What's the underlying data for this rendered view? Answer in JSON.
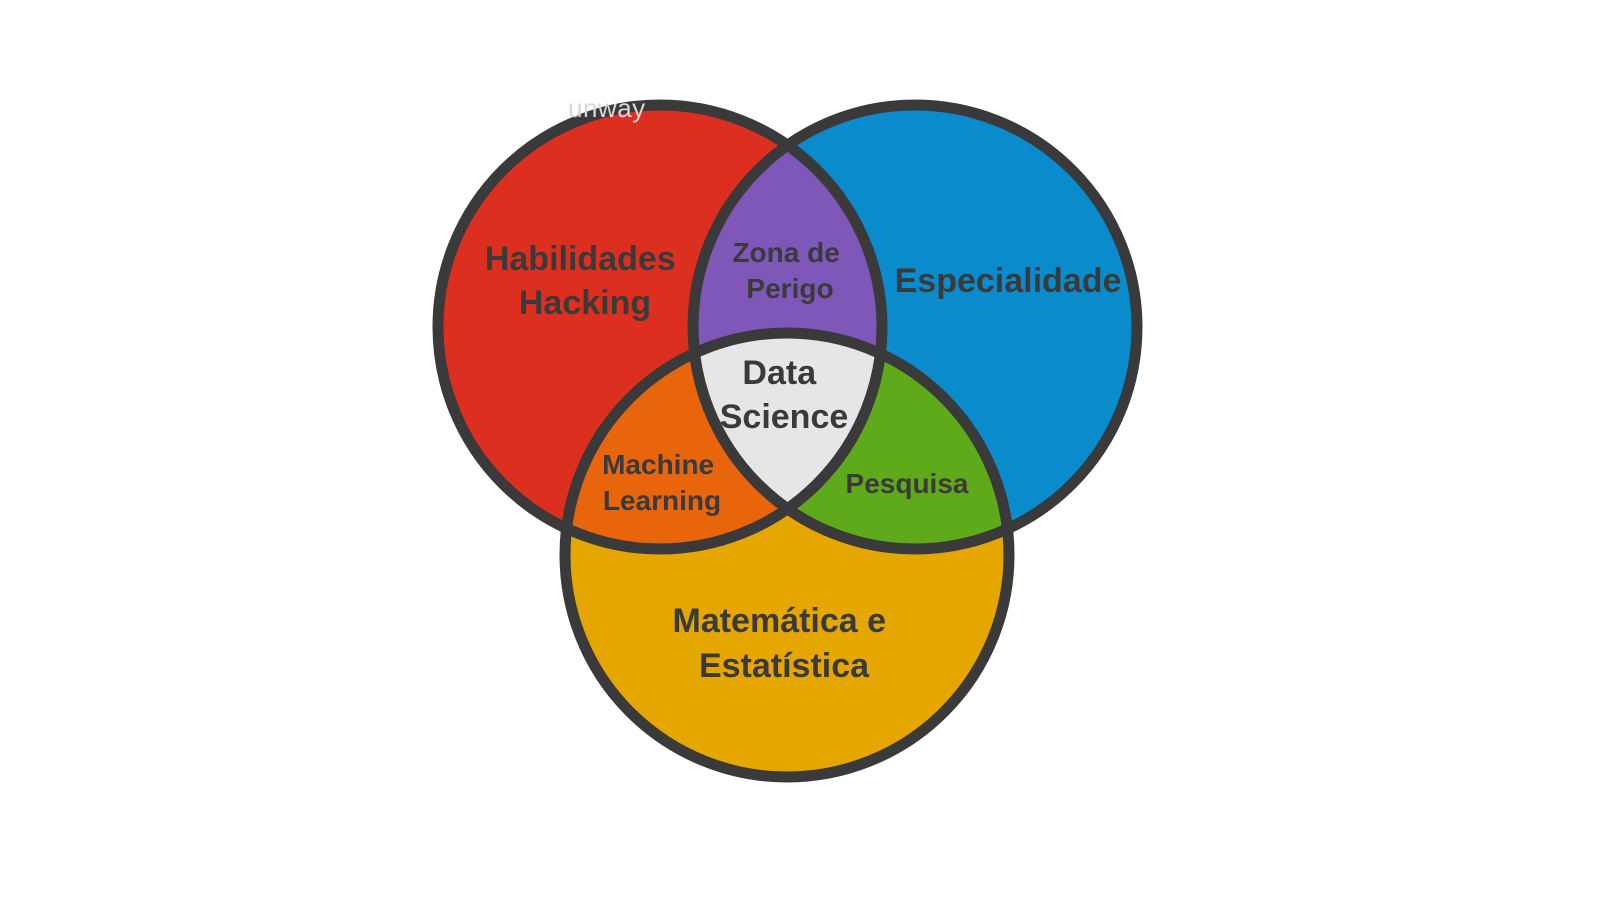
{
  "watermark": "unway",
  "colors": {
    "hacking": "#dc2f1f",
    "expertise": "#0a8bcb",
    "math": "#e6a600",
    "danger_zone": "#7e57b8",
    "machine_learning": "#e8650c",
    "research": "#5faa1a",
    "data_science": "#e5e6e7",
    "outline": "#3a3a3a",
    "label_text": "#3a3a3a"
  },
  "sets": {
    "hacking": [
      "Habilidades",
      "Hacking"
    ],
    "expertise": [
      "Especialidade"
    ],
    "math": [
      "Matemática e",
      "Estatística"
    ]
  },
  "intersections": {
    "danger_zone": [
      "Zona de",
      "Perigo"
    ],
    "machine_learning": [
      "Machine",
      "Learning"
    ],
    "research": [
      "Pesquisa"
    ],
    "data_science": [
      "Data",
      "Science"
    ]
  }
}
